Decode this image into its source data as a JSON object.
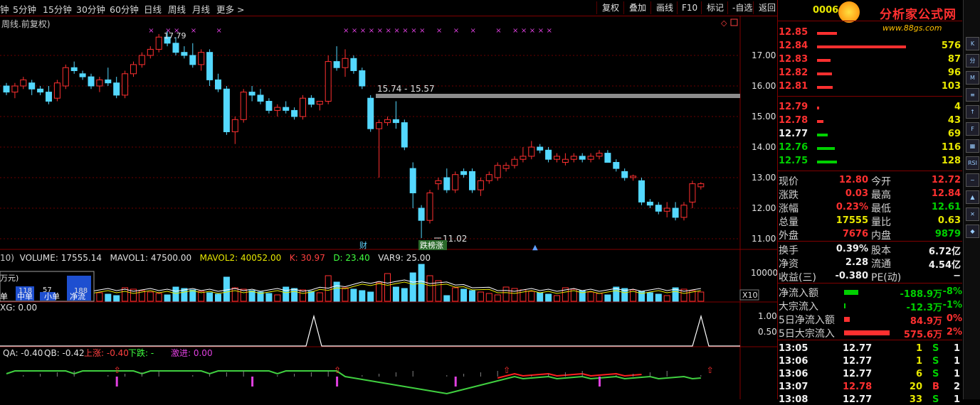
{
  "toolbar": {
    "periods": [
      "钟",
      "5分钟",
      "15分钟",
      "30分钟",
      "60分钟",
      "日线",
      "周线",
      "月线",
      "更多 >"
    ],
    "buttons": [
      "复权",
      "叠加",
      "画线",
      "F10",
      "标记",
      "-自选",
      "返回"
    ]
  },
  "chart": {
    "subtitle": "周线.前复权)",
    "high_label": "17.79",
    "low_label": "11.02",
    "band_label": "15.74 - 15.57",
    "tag_cai": "财",
    "tag_rank": "跌榜涨",
    "y_ticks": [
      "17.00",
      "16.00",
      "15.00",
      "14.00",
      "13.00",
      "12.00",
      "11.00"
    ]
  },
  "chart_data": {
    "type": "candlestick",
    "ylim": [
      10.8,
      17.9
    ],
    "candles": [
      [
        16.0,
        16.1,
        15.7,
        15.8
      ],
      [
        15.8,
        16.1,
        15.6,
        16.0
      ],
      [
        16.0,
        16.3,
        15.9,
        16.2
      ],
      [
        16.1,
        16.2,
        15.7,
        15.9
      ],
      [
        15.9,
        16.0,
        15.7,
        15.8
      ],
      [
        15.8,
        16.0,
        15.4,
        15.5
      ],
      [
        15.6,
        16.2,
        15.5,
        16.1
      ],
      [
        16.0,
        16.7,
        15.9,
        16.6
      ],
      [
        16.6,
        16.8,
        16.4,
        16.5
      ],
      [
        16.4,
        16.5,
        16.2,
        16.3
      ],
      [
        16.3,
        16.4,
        15.9,
        16.0
      ],
      [
        16.0,
        16.3,
        15.8,
        16.2
      ],
      [
        16.2,
        16.6,
        16.0,
        16.1
      ],
      [
        16.1,
        16.3,
        15.6,
        15.7
      ],
      [
        15.7,
        16.5,
        15.6,
        16.4
      ],
      [
        16.4,
        16.8,
        16.3,
        16.7
      ],
      [
        16.7,
        17.1,
        16.6,
        17.0
      ],
      [
        17.0,
        17.3,
        16.9,
        17.2
      ],
      [
        17.2,
        17.7,
        17.1,
        17.6
      ],
      [
        17.6,
        17.79,
        17.3,
        17.4
      ],
      [
        17.4,
        17.6,
        17.0,
        17.1
      ],
      [
        17.1,
        17.3,
        16.9,
        17.0
      ],
      [
        17.0,
        17.4,
        16.6,
        16.7
      ],
      [
        16.7,
        17.2,
        16.5,
        17.1
      ],
      [
        17.1,
        17.2,
        16.0,
        16.2
      ],
      [
        16.2,
        16.4,
        15.8,
        15.9
      ],
      [
        15.9,
        16.0,
        14.4,
        14.5
      ],
      [
        14.5,
        15.0,
        14.1,
        14.9
      ],
      [
        14.9,
        15.9,
        14.8,
        15.8
      ],
      [
        15.8,
        16.0,
        15.5,
        15.7
      ],
      [
        15.7,
        15.9,
        15.4,
        15.5
      ],
      [
        15.5,
        15.6,
        15.1,
        15.2
      ],
      [
        15.2,
        15.4,
        15.0,
        15.3
      ],
      [
        15.3,
        15.5,
        15.1,
        15.2
      ],
      [
        15.2,
        15.3,
        14.9,
        15.0
      ],
      [
        15.0,
        15.7,
        14.9,
        15.6
      ],
      [
        15.6,
        15.7,
        15.3,
        15.4
      ],
      [
        15.4,
        15.5,
        15.2,
        15.5
      ],
      [
        15.5,
        17.0,
        15.4,
        16.8
      ],
      [
        16.8,
        17.3,
        16.5,
        16.6
      ],
      [
        16.6,
        17.2,
        16.3,
        16.9
      ],
      [
        16.9,
        17.0,
        16.4,
        16.5
      ],
      [
        16.5,
        16.6,
        15.9,
        16.0
      ],
      [
        15.6,
        15.7,
        14.5,
        14.6
      ],
      [
        14.6,
        14.9,
        13.0,
        14.8
      ],
      [
        14.8,
        15.0,
        14.7,
        14.9
      ],
      [
        14.9,
        15.5,
        14.6,
        14.8
      ],
      [
        14.8,
        14.9,
        13.9,
        14.0
      ],
      [
        13.3,
        13.5,
        12.0,
        12.5
      ],
      [
        12.0,
        12.1,
        11.02,
        11.6
      ],
      [
        11.6,
        12.6,
        11.5,
        12.5
      ],
      [
        12.8,
        13.0,
        12.6,
        12.9
      ],
      [
        13.0,
        13.3,
        12.5,
        12.6
      ],
      [
        12.6,
        13.2,
        12.5,
        13.1
      ],
      [
        13.2,
        13.3,
        13.0,
        13.1
      ],
      [
        13.2,
        13.3,
        12.5,
        12.6
      ],
      [
        12.6,
        13.0,
        12.4,
        12.9
      ],
      [
        12.9,
        13.2,
        12.8,
        13.1
      ],
      [
        13.0,
        13.5,
        12.9,
        13.4
      ],
      [
        13.3,
        13.5,
        13.2,
        13.4
      ],
      [
        13.4,
        13.7,
        13.3,
        13.6
      ],
      [
        13.6,
        14.0,
        13.5,
        13.7
      ],
      [
        13.7,
        14.2,
        13.6,
        14.0
      ],
      [
        14.0,
        14.1,
        13.8,
        13.9
      ],
      [
        13.9,
        14.0,
        13.5,
        13.6
      ],
      [
        13.6,
        13.8,
        13.5,
        13.7
      ],
      [
        13.5,
        13.8,
        13.4,
        13.6
      ],
      [
        13.6,
        13.8,
        13.5,
        13.7
      ],
      [
        13.7,
        13.8,
        13.5,
        13.6
      ],
      [
        13.6,
        13.8,
        13.5,
        13.7
      ],
      [
        13.7,
        13.9,
        13.6,
        13.8
      ],
      [
        13.8,
        13.9,
        13.5,
        13.5
      ],
      [
        13.5,
        13.6,
        13.2,
        13.3
      ],
      [
        13.2,
        13.3,
        12.9,
        13.0
      ],
      [
        13.0,
        13.1,
        12.9,
        13.05
      ],
      [
        12.9,
        13.0,
        12.1,
        12.2
      ],
      [
        12.2,
        12.3,
        12.0,
        12.1
      ],
      [
        12.1,
        12.2,
        11.8,
        11.9
      ],
      [
        11.9,
        12.2,
        11.7,
        12.0
      ],
      [
        12.0,
        12.2,
        11.6,
        11.7
      ],
      [
        11.7,
        12.2,
        11.6,
        12.1
      ],
      [
        12.2,
        12.9,
        12.0,
        12.8
      ],
      [
        12.7,
        12.85,
        12.61,
        12.8
      ]
    ],
    "volume_labels": [
      "VOLUME: 17555.14",
      "MAVOL1: 47500.00",
      "MAVOL2: 40052.00",
      "K: 30.97",
      "D: 23.40",
      "VAR9: 25.00"
    ],
    "xg_label": "XG: 0.00",
    "qa_labels": [
      "QA: -0.40",
      "QB: -0.42",
      "上涨: -0.40",
      "下跌: -",
      "激进: 0.00"
    ],
    "volume_axis": "10000",
    "xg_axis": [
      "1.00",
      "0.50"
    ],
    "x10": "X10"
  },
  "capital_box": {
    "unit": "万元)",
    "vals": [
      "118",
      "57",
      "188"
    ],
    "labels": [
      "单",
      "中单",
      "小单",
      "净流"
    ]
  },
  "quote": {
    "code": "0006",
    "logo": "分析家公式网",
    "site": "www.88gs.com",
    "sell": [
      {
        "price": "12.85",
        "vol": ""
      },
      {
        "price": "12.84",
        "vol": "576"
      },
      {
        "price": "12.83",
        "vol": "87"
      },
      {
        "price": "12.82",
        "vol": "96"
      },
      {
        "price": "12.81",
        "vol": "103"
      }
    ],
    "buy": [
      {
        "price": "12.79",
        "vol": "4"
      },
      {
        "price": "12.78",
        "vol": "43"
      },
      {
        "price": "12.77",
        "vol": "69"
      },
      {
        "price": "12.76",
        "vol": "116"
      },
      {
        "price": "12.75",
        "vol": "128"
      }
    ],
    "stats": [
      [
        "现价",
        "12.80",
        "今开",
        "12.72"
      ],
      [
        "涨跌",
        "0.03",
        "最高",
        "12.84"
      ],
      [
        "涨幅",
        "0.23%",
        "最低",
        "12.61"
      ],
      [
        "总量",
        "17555",
        "量比",
        "0.63"
      ],
      [
        "外盘",
        "7676",
        "内盘",
        "9879"
      ]
    ],
    "stats2": [
      [
        "换手",
        "0.39%",
        "股本",
        "6.72亿"
      ],
      [
        "净资",
        "2.28",
        "流通",
        "4.54亿"
      ],
      [
        "收益(三)",
        "-0.380",
        "PE(动)",
        "−"
      ]
    ],
    "flows": [
      [
        "净流入额",
        "-188.9万",
        "-8%"
      ],
      [
        "大宗流入",
        "-12.3万",
        "-1%"
      ],
      [
        "5日净流入额",
        "84.9万",
        "0%"
      ],
      [
        "5日大宗流入",
        "575.6万",
        "2%"
      ]
    ],
    "ticks": [
      [
        "13:05",
        "12.77",
        "1",
        "S",
        "1"
      ],
      [
        "13:06",
        "12.77",
        "1",
        "S",
        "1"
      ],
      [
        "13:06",
        "12.77",
        "6",
        "S",
        "1"
      ],
      [
        "13:07",
        "12.78",
        "20",
        "B",
        "2"
      ],
      [
        "13:08",
        "12.77",
        "33",
        "S",
        "1"
      ]
    ]
  },
  "colors": {
    "up": "#ff3030",
    "down": "#54d8ff",
    "frame": "#800000",
    "grid": "#6a0000"
  },
  "side_icons": [
    "K",
    "分",
    "M",
    "≡",
    "↑",
    "F",
    "▦",
    "RSI",
    "~",
    "▲",
    "✕",
    "◆"
  ]
}
